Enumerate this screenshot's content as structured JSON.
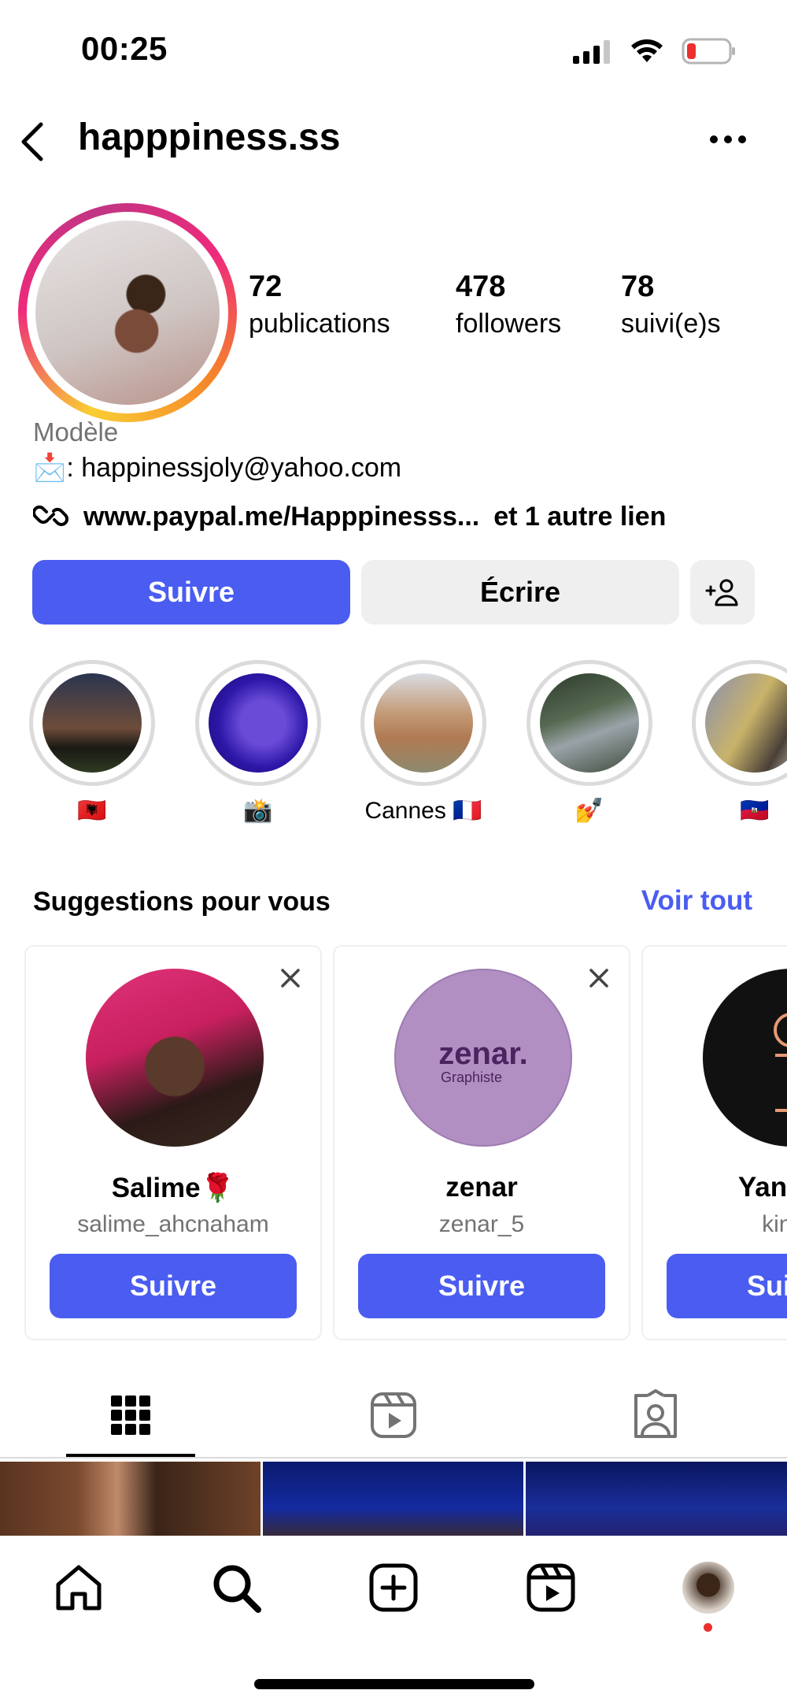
{
  "status_bar": {
    "time": "00:25"
  },
  "header": {
    "username": "happpiness.ss"
  },
  "profile": {
    "stats": [
      {
        "count": "72",
        "label": "publications"
      },
      {
        "count": "478",
        "label": "followers"
      },
      {
        "count": "78",
        "label": "suivi(e)s"
      }
    ],
    "category": "Modèle",
    "email_line": "📩: happinessjoly@yahoo.com",
    "link_text": "www.paypal.me/Happpinesss...",
    "link_more": "et 1 autre lien"
  },
  "actions": {
    "follow_label": "Suivre",
    "message_label": "Écrire"
  },
  "highlights": [
    {
      "label": "🇦🇱"
    },
    {
      "label": "📸"
    },
    {
      "label": "Cannes 🇫🇷"
    },
    {
      "label": "💅"
    },
    {
      "label": "🇭🇹"
    }
  ],
  "suggestions": {
    "title": "Suggestions pour vous",
    "see_all": "Voir tout",
    "cards": [
      {
        "name": "Salime🌹",
        "handle": "salime_ahcnaham",
        "button": "Suivre"
      },
      {
        "name": "zenar",
        "handle": "zenar_5",
        "button": "Suivre",
        "logo_text": "zenar.",
        "logo_sub": "Graphiste"
      },
      {
        "name": "Yannick",
        "handle": "king_",
        "button": "Suivre"
      }
    ]
  },
  "colors": {
    "accent": "#4a5df0",
    "secondary_button": "#efefef",
    "muted_text": "#737373",
    "notification_dot": "#ed2f2f"
  },
  "icons": {
    "status": [
      "cellular-signal-icon",
      "wifi-icon",
      "battery-low-icon"
    ],
    "tabs": [
      "grid-icon",
      "reels-icon",
      "tagged-icon"
    ],
    "bottom_nav": [
      "home-icon",
      "search-icon",
      "create-icon",
      "reels-icon",
      "profile-avatar"
    ]
  }
}
